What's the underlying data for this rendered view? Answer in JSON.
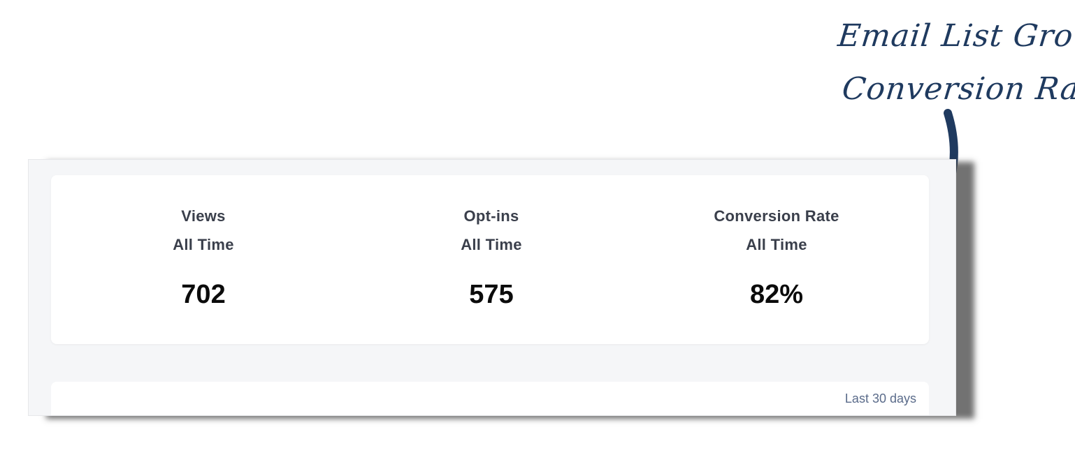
{
  "annotation": {
    "line1": "Email List Growth",
    "line2": "Conversion Rate!",
    "color": "#1f3a5f"
  },
  "stats": [
    {
      "label": "Views",
      "period": "All Time",
      "value": "702"
    },
    {
      "label": "Opt-ins",
      "period": "All Time",
      "value": "575"
    },
    {
      "label": "Conversion Rate",
      "period": "All Time",
      "value": "82%"
    }
  ],
  "chart_card": {
    "range_label": "Last 30 days"
  }
}
